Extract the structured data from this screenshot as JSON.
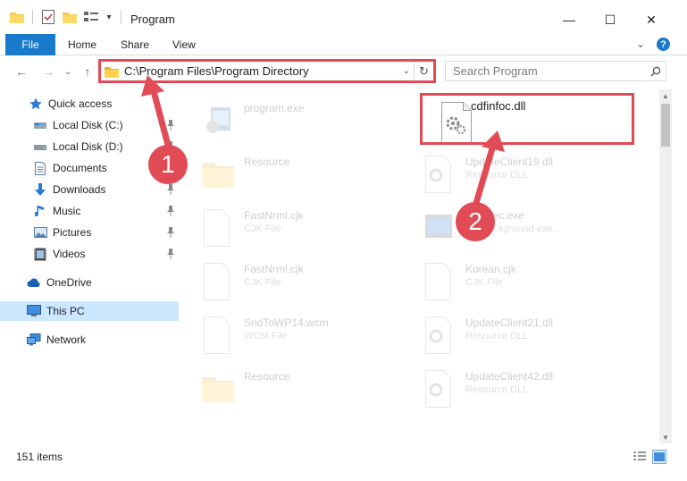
{
  "window": {
    "title": "Program",
    "minimize_glyph": "—",
    "maximize_glyph": "☐",
    "close_glyph": "✕"
  },
  "ribbon": {
    "tabs": [
      {
        "label": "File"
      },
      {
        "label": "Home"
      },
      {
        "label": "Share"
      },
      {
        "label": "View"
      }
    ],
    "collapse_glyph": "⌄",
    "help_glyph": "?"
  },
  "nav": {
    "back_glyph": "←",
    "forward_glyph": "→",
    "recent_glyph": "⌄",
    "up_glyph": "↑",
    "address": "C:\\Program Files\\Program Directory",
    "dropdown_glyph": "⌄",
    "refresh_glyph": "↻",
    "search_placeholder": "Search Program"
  },
  "sidebar": {
    "items": [
      {
        "label": "Quick access",
        "icon": "star-icon"
      },
      {
        "label": "Local Disk (C:)",
        "icon": "drive-icon",
        "pinned": true
      },
      {
        "label": "Local Disk (D:)",
        "icon": "drive-icon",
        "pinned": true
      },
      {
        "label": "Documents",
        "icon": "document-icon",
        "pinned": true
      },
      {
        "label": "Downloads",
        "icon": "download-icon",
        "pinned": true
      },
      {
        "label": "Music",
        "icon": "music-icon",
        "pinned": true
      },
      {
        "label": "Pictures",
        "icon": "picture-icon",
        "pinned": true
      },
      {
        "label": "Videos",
        "icon": "video-icon",
        "pinned": true
      },
      {
        "label": "OneDrive",
        "icon": "cloud-icon"
      },
      {
        "label": "This PC",
        "icon": "computer-icon",
        "selected": true
      },
      {
        "label": "Network",
        "icon": "network-icon"
      }
    ]
  },
  "files": [
    {
      "name": "program.exe",
      "type": "",
      "icon": "exe-icon"
    },
    {
      "name": "cdfinfoc.dll",
      "type": "",
      "icon": "dll-icon",
      "highlighted": true
    },
    {
      "name": "Resource",
      "type": "",
      "icon": "folder-icon"
    },
    {
      "name": "UpdateClient19.dll",
      "type": "Resource DLL",
      "icon": "dll-icon"
    },
    {
      "name": "FastNrml.cjk",
      "type": "CJK File",
      "icon": "file-icon"
    },
    {
      "name": "...eExec.exe",
      "type": "...Y background exe...",
      "icon": "exe-icon"
    },
    {
      "name": "FastNrml.cjk",
      "type": "CJK File",
      "icon": "file-icon"
    },
    {
      "name": "Korean.cjk",
      "type": "CJK File",
      "icon": "file-icon"
    },
    {
      "name": "SndToWP14.wcm",
      "type": "WCM File",
      "icon": "file-icon"
    },
    {
      "name": "UpdateClient21.dll",
      "type": "Resource DLL",
      "icon": "dll-icon"
    },
    {
      "name": "Resource",
      "type": "",
      "icon": "folder-icon"
    },
    {
      "name": "UpdateClient42.dll",
      "type": "Resource DLL",
      "icon": "dll-icon"
    }
  ],
  "annotations": {
    "step1": "1",
    "step2": "2",
    "color": "#e04b55"
  },
  "status": {
    "item_count": "151 items"
  }
}
